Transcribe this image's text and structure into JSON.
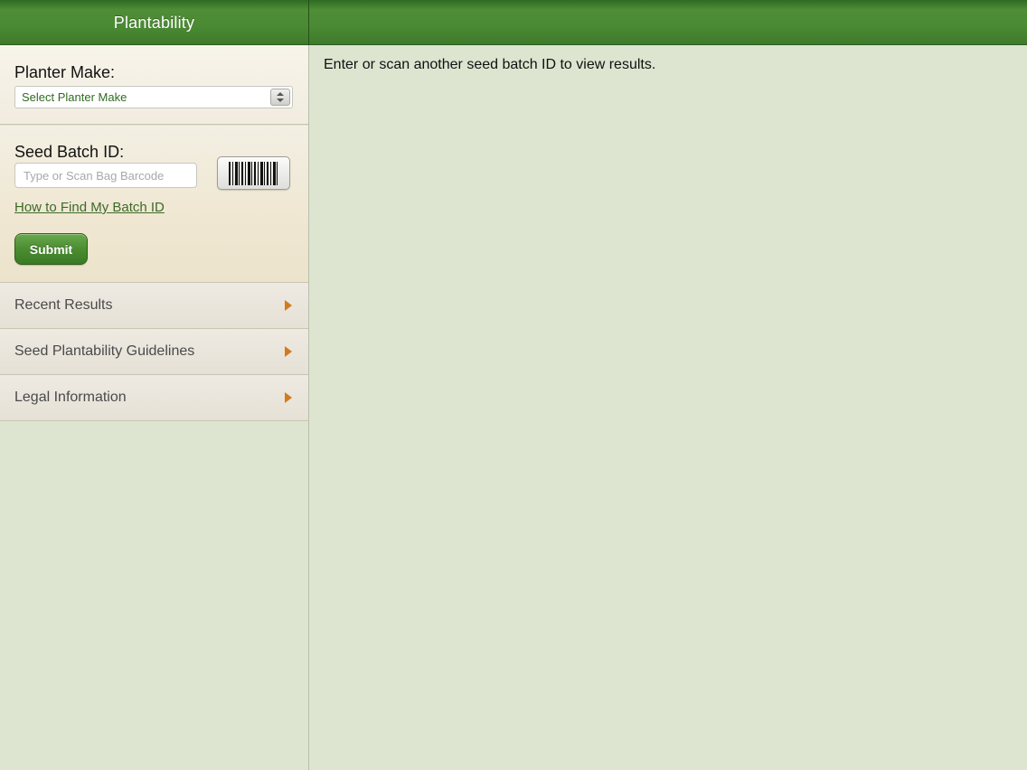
{
  "header": {
    "title": "Plantability",
    "color": "#4a8a33"
  },
  "planter": {
    "label": "Planter Make:",
    "selected_value": "Select Planter Make"
  },
  "batch": {
    "label": "Seed Batch ID:",
    "placeholder": "Type or Scan Bag Barcode",
    "help_link": "How to Find My Batch ID",
    "submit_label": "Submit"
  },
  "menu": {
    "items": [
      {
        "label": "Recent Results"
      },
      {
        "label": "Seed Plantability Guidelines"
      },
      {
        "label": "Legal Information"
      }
    ]
  },
  "main": {
    "message": "Enter or scan another seed batch ID to view results."
  }
}
